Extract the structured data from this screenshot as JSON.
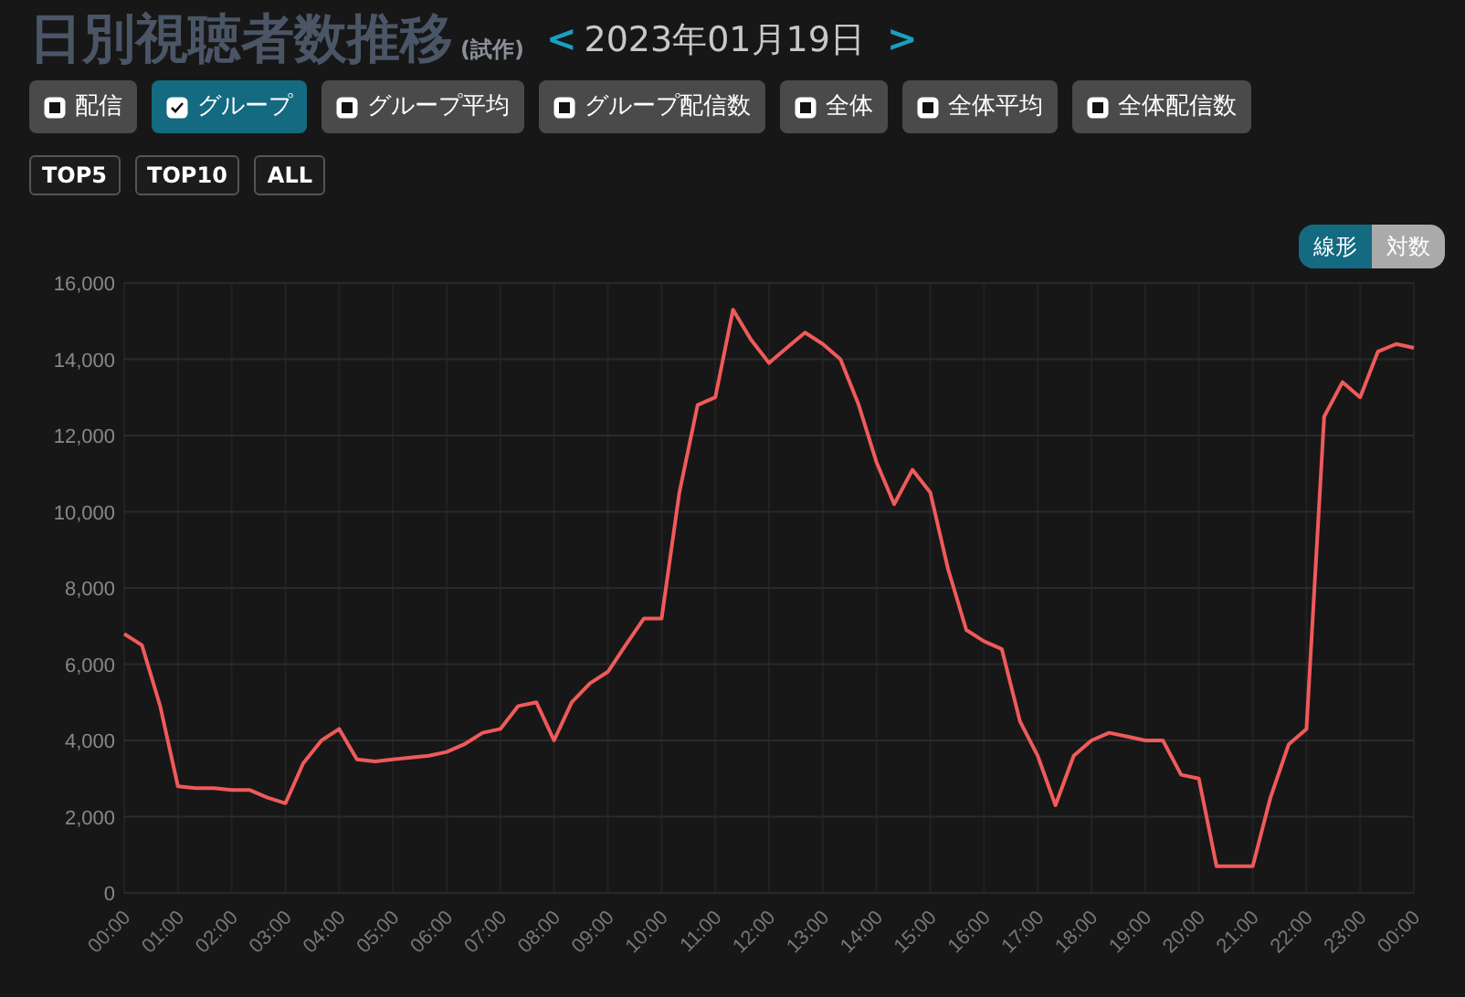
{
  "header": {
    "title": "日別視聴者数推移",
    "subtitle": "(試作)",
    "prev": "<",
    "date": "2023年01月19日",
    "next": ">"
  },
  "filters": [
    {
      "label": "配信",
      "checked": false
    },
    {
      "label": "グループ",
      "checked": true
    },
    {
      "label": "グループ平均",
      "checked": false
    },
    {
      "label": "グループ配信数",
      "checked": false
    },
    {
      "label": "全体",
      "checked": false
    },
    {
      "label": "全体平均",
      "checked": false
    },
    {
      "label": "全体配信数",
      "checked": false
    }
  ],
  "ranges": [
    {
      "label": "TOP5"
    },
    {
      "label": "TOP10"
    },
    {
      "label": "ALL"
    }
  ],
  "scale_toggle": [
    {
      "label": "線形",
      "selected": true
    },
    {
      "label": "対数",
      "selected": false
    }
  ],
  "chart": {
    "chart_data": {
      "type": "line",
      "x": [
        0,
        0.33,
        0.67,
        1,
        1.33,
        1.67,
        2,
        2.33,
        2.67,
        3,
        3.33,
        3.67,
        4,
        4.33,
        4.67,
        5,
        5.33,
        5.67,
        6,
        6.33,
        6.67,
        7,
        7.33,
        7.67,
        8,
        8.33,
        8.67,
        9,
        9.33,
        9.67,
        10,
        10.33,
        10.67,
        11,
        11.33,
        11.67,
        12,
        12.33,
        12.67,
        13,
        13.33,
        13.67,
        14,
        14.33,
        14.67,
        15,
        15.33,
        15.67,
        16,
        16.33,
        16.67,
        17,
        17.33,
        17.67,
        18,
        18.33,
        18.67,
        19,
        19.33,
        19.67,
        20,
        20.33,
        20.67,
        21,
        21.33,
        21.67,
        22,
        22.33,
        22.67,
        23,
        23.33,
        23.67,
        24
      ],
      "grid": true,
      "series": [
        {
          "color": "#f05a5a",
          "values": [
            6800,
            6500,
            4900,
            2800,
            2750,
            2750,
            2700,
            2700,
            2500,
            2350,
            3400,
            4000,
            4300,
            3500,
            3450,
            3500,
            3550,
            3600,
            3700,
            3900,
            4200,
            4300,
            4900,
            5000,
            4000,
            5000,
            5500,
            5800,
            6500,
            7200,
            7200,
            10500,
            12800,
            13000,
            15300,
            14500,
            13900,
            14300,
            14700,
            14400,
            14000,
            12800,
            11300,
            10200,
            11100,
            10500,
            8500,
            6900,
            6600,
            6400,
            4500,
            3600,
            2300,
            3600,
            4000,
            4200,
            4100,
            4000,
            4000,
            3100,
            3000,
            700,
            700,
            700,
            2500,
            3900,
            4300,
            12500,
            13400,
            13000,
            14200,
            14400,
            14300
          ]
        }
      ],
      "xlim": [
        0,
        24
      ],
      "ylim": [
        0,
        16000
      ],
      "xticks": [
        {
          "value": 0,
          "label": "00:00"
        },
        {
          "value": 1,
          "label": "01:00"
        },
        {
          "value": 2,
          "label": "02:00"
        },
        {
          "value": 3,
          "label": "03:00"
        },
        {
          "value": 4,
          "label": "04:00"
        },
        {
          "value": 5,
          "label": "05:00"
        },
        {
          "value": 6,
          "label": "06:00"
        },
        {
          "value": 7,
          "label": "07:00"
        },
        {
          "value": 8,
          "label": "08:00"
        },
        {
          "value": 9,
          "label": "09:00"
        },
        {
          "value": 10,
          "label": "10:00"
        },
        {
          "value": 11,
          "label": "11:00"
        },
        {
          "value": 12,
          "label": "12:00"
        },
        {
          "value": 13,
          "label": "13:00"
        },
        {
          "value": 14,
          "label": "14:00"
        },
        {
          "value": 15,
          "label": "15:00"
        },
        {
          "value": 16,
          "label": "16:00"
        },
        {
          "value": 17,
          "label": "17:00"
        },
        {
          "value": 18,
          "label": "18:00"
        },
        {
          "value": 19,
          "label": "19:00"
        },
        {
          "value": 20,
          "label": "20:00"
        },
        {
          "value": 21,
          "label": "21:00"
        },
        {
          "value": 22,
          "label": "22:00"
        },
        {
          "value": 23,
          "label": "23:00"
        },
        {
          "value": 24,
          "label": "00:00"
        }
      ],
      "yticks": [
        {
          "value": 0,
          "label": "0"
        },
        {
          "value": 2000,
          "label": "2,000"
        },
        {
          "value": 4000,
          "label": "4,000"
        },
        {
          "value": 6000,
          "label": "6,000"
        },
        {
          "value": 8000,
          "label": "8,000"
        },
        {
          "value": 10000,
          "label": "10,000"
        },
        {
          "value": 12000,
          "label": "12,000"
        },
        {
          "value": 14000,
          "label": "14,000"
        },
        {
          "value": 16000,
          "label": "16,000"
        }
      ]
    }
  }
}
